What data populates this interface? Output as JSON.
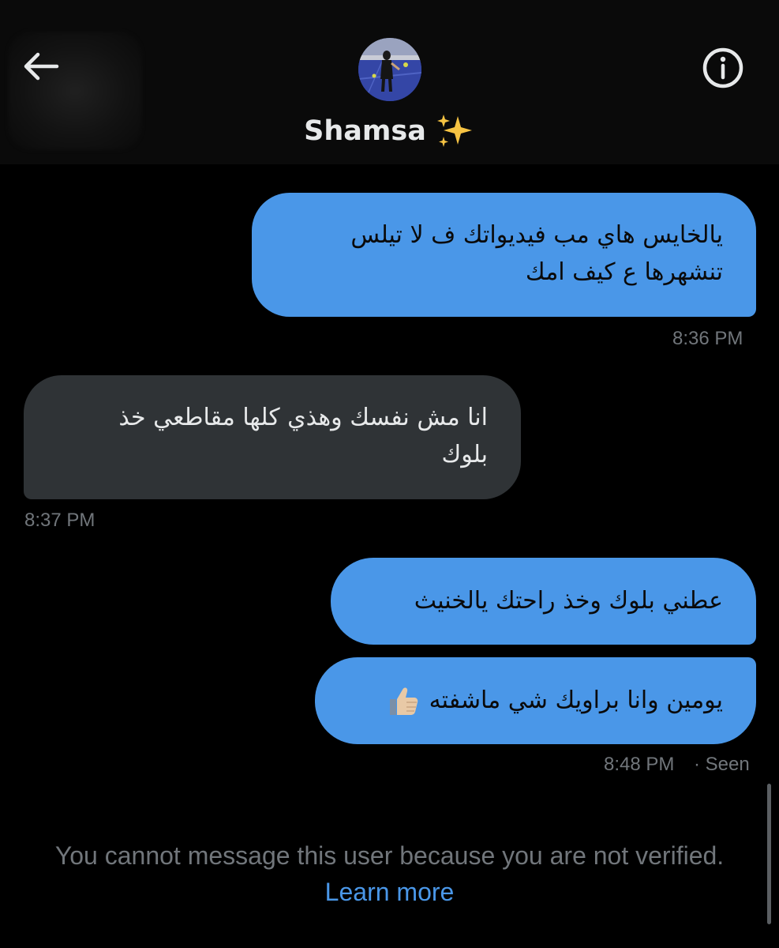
{
  "header": {
    "contact_name": "Shamsa",
    "name_emoji": "sparkles-emoji",
    "back_icon": "back-arrow-icon",
    "info_icon": "info-icon"
  },
  "messages": [
    {
      "direction": "sent",
      "lines": [
        "يالخايس هاي مب فيديواتك ف لا تيلس",
        "تنشهرها ع كيف امك"
      ],
      "time": "8:36 PM"
    },
    {
      "direction": "received",
      "lines": [
        "انا مش نفسك وهذي كلها مقاطعي خذ",
        "بلوك"
      ],
      "time": "8:37 PM"
    },
    {
      "direction": "sent",
      "lines": [
        "عطني بلوك وخذ راحتك يالخنيث"
      ]
    },
    {
      "direction": "sent",
      "lines": [
        "يومين وانا براويك شي ماشفته"
      ],
      "emoji": "thumbs-up-emoji",
      "time": "8:48 PM",
      "status": "· Seen"
    }
  ],
  "notice": {
    "text": "You cannot message this user because you are not verified.",
    "link": "Learn more"
  },
  "colors": {
    "background": "#000000",
    "sent_bubble": "#4a97e8",
    "received_bubble": "#2f3336",
    "muted_text": "#71767b",
    "link": "#4a97e8"
  }
}
